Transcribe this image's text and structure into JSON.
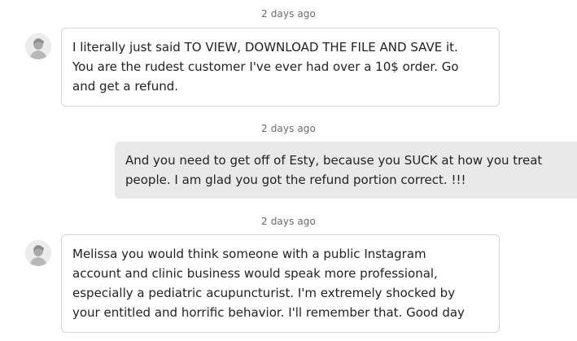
{
  "messages": [
    {
      "timestamp": "2 days ago",
      "direction": "incoming",
      "avatar_icon": "user-avatar-icon",
      "text": "I literally just said TO VIEW, DOWNLOAD THE FILE AND SAVE it.\nYou are the rudest customer I've ever had over a 10$ order. Go\nand get a refund."
    },
    {
      "timestamp": "2 days ago",
      "direction": "outgoing",
      "text": "And you need to get off of Esty, because you SUCK at how you treat\npeople. I am glad you got the refund portion correct. !!!"
    },
    {
      "timestamp": "2 days ago",
      "direction": "incoming",
      "avatar_icon": "user-avatar-icon",
      "text": "Melissa you would think someone with a public Instagram\naccount and clinic business would speak more professional,\nespecially a pediatric acupuncturist. I'm extremely shocked by\nyour entitled and horrific behavior. I'll remember that. Good day"
    }
  ],
  "colors": {
    "incoming_bg": "#ffffff",
    "incoming_border": "#d5d5d5",
    "outgoing_bg": "#e9e9e9",
    "timestamp_text": "#6b6b6b",
    "message_text": "#222222"
  }
}
